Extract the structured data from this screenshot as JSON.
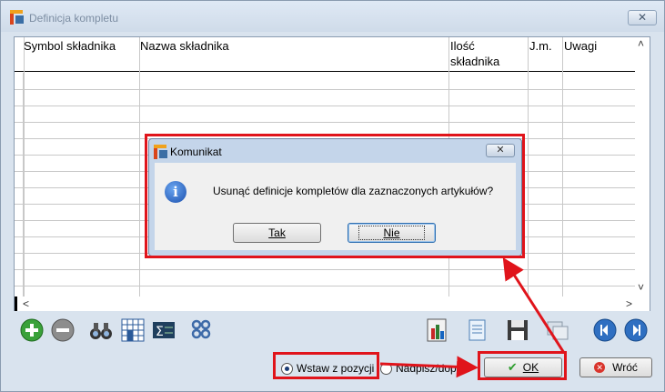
{
  "window": {
    "title": "Definicja kompletu",
    "close_glyph": "✕"
  },
  "grid": {
    "columns": [
      "Symbol składnika",
      "Nazwa składnika",
      "Ilość\nskładnika",
      "J.m.",
      "Uwagi"
    ],
    "scroll_up": "˄",
    "scroll_down": "˅",
    "scroll_left": "<",
    "scroll_right": ">"
  },
  "toolbar": {
    "icons": [
      "add-icon",
      "remove-icon",
      "binoculars-icon",
      "grid-view-icon",
      "sum-icon",
      "links-icon",
      "chart-report-icon",
      "document-icon",
      "save-icon",
      "windows-icon",
      "first-record-icon",
      "last-record-icon"
    ]
  },
  "bottom": {
    "radio_insert": "Wstaw z pozycji",
    "radio_overwrite": "Nadpisz/dopisz",
    "ok": "OK",
    "back": "Wróć"
  },
  "dialog": {
    "title": "Komunikat",
    "message": "Usunąć definicje kompletów dla zaznaczonych artykułów?",
    "yes": "Tak",
    "no": "Nie",
    "close_glyph": "✕"
  },
  "colors": {
    "highlight": "#e0141b",
    "window_bg": "#d9e3ee",
    "dialog_frame": "#c4d5ea"
  }
}
